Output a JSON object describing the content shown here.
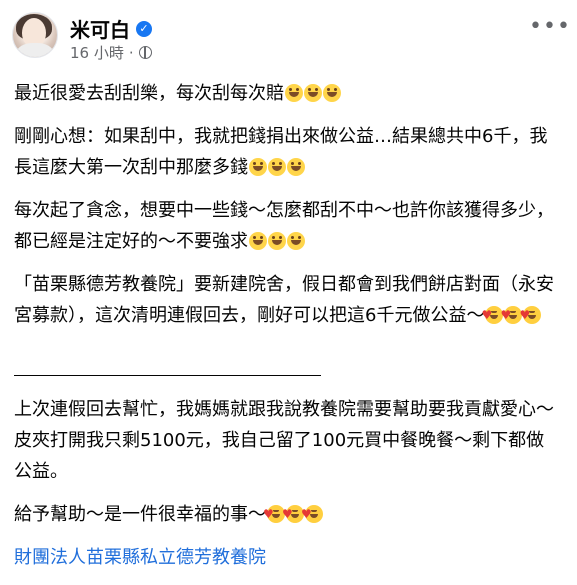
{
  "author": {
    "name": "米可白",
    "time": "16 小時",
    "separator": "·"
  },
  "post": {
    "p1": "最近很愛去刮刮樂，每次刮每次賠",
    "p2": "剛剛心想：如果刮中，我就把錢捐出來做公益…結果總共中6千，我長這麼大第一次刮中那麼多錢",
    "p3": "每次起了貪念，想要中一些錢～怎麼都刮不中～也許你該獲得多少，都已經是注定好的～不要強求",
    "p4": "「苗栗縣德芳教養院」要新建院舍，假日都會到我們餅店對面（永安宮募款），這次清明連假回去，剛好可以把這6千元做公益～",
    "p5": "上次連假回去幫忙，我媽媽就跟我說教養院需要幫助要我貢獻愛心～皮夾打開我只剩5100元，我自己留了100元買中餐晚餐～剩下都做公益。",
    "p6": "給予幫助～是一件很幸福的事～",
    "tag": "財團法人苗栗縣私立德芳教養院"
  },
  "icons": {
    "verified": "verified-badge-icon",
    "audience": "globe-icon",
    "more": "more-options-icon",
    "grin": "grinning-face-emoji",
    "love": "smiling-face-with-hearts-emoji"
  },
  "colors": {
    "text": "#050505",
    "secondary": "#65676b",
    "link": "#216fdb",
    "verified": "#1877f2"
  }
}
